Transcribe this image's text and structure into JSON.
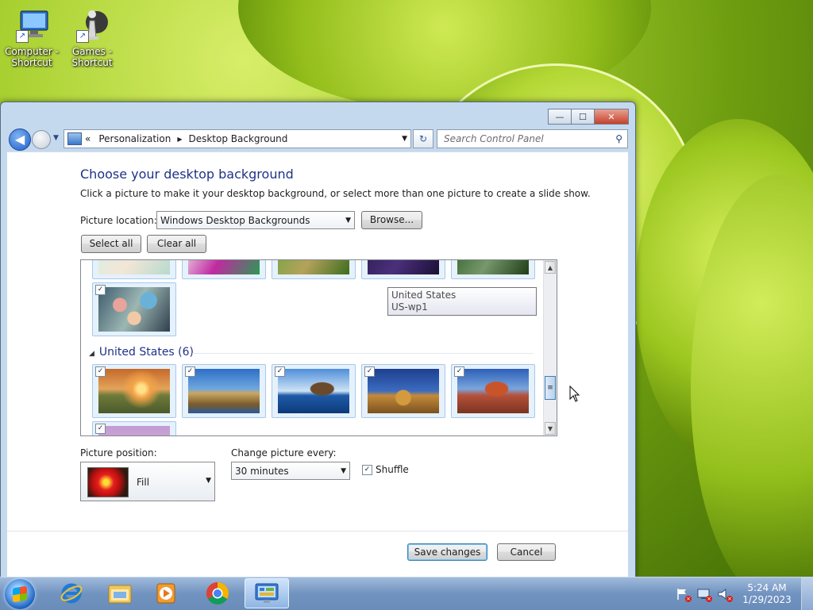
{
  "desktop": {
    "icons": [
      {
        "label": "Computer - Shortcut",
        "line1": "Computer -",
        "line2": "Shortcut"
      },
      {
        "label": "Games - Shortcut",
        "line1": "Games -",
        "line2": "Shortcut"
      }
    ]
  },
  "window": {
    "controls": {
      "minimize": "—",
      "maximize": "☐",
      "close": "✕"
    },
    "breadcrumb": {
      "prefix": "«",
      "items": [
        "Personalization",
        "Desktop Background"
      ]
    },
    "search": {
      "placeholder": "Search Control Panel"
    }
  },
  "page": {
    "heading": "Choose your desktop background",
    "instruction": "Click a picture to make it your desktop background, or select more than one picture to create a slide show.",
    "location_label": "Picture location:",
    "location_value": "Windows Desktop Backgrounds",
    "browse_label": "Browse...",
    "select_all_label": "Select all",
    "clear_all_label": "Clear all"
  },
  "gallery": {
    "tooltip": {
      "line1": "United States",
      "line2": "US-wp1"
    },
    "group": {
      "title": "United States (6)",
      "count": 6
    },
    "colors": {
      "tile_selected_border": "#a8c8ec",
      "tile_selected_bg": "#e5f1fb"
    }
  },
  "options": {
    "position_label": "Picture position:",
    "position_value": "Fill",
    "change_label": "Change picture every:",
    "change_value": "30 minutes",
    "shuffle_label": "Shuffle",
    "shuffle_checked": true
  },
  "footer": {
    "save_label": "Save changes",
    "cancel_label": "Cancel"
  },
  "taskbar": {
    "items": [
      "internet-explorer-icon",
      "windows-explorer-icon",
      "media-player-icon",
      "chrome-icon",
      "control-panel-icon"
    ],
    "clock_time": "5:24 AM",
    "clock_date": "1/29/2023"
  }
}
